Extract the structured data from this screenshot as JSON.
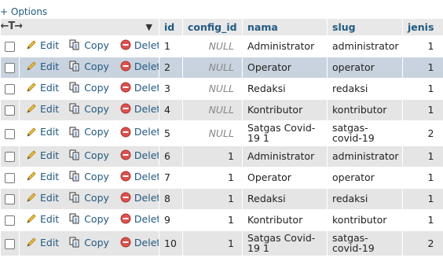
{
  "options_link": "+ Options",
  "columns": [
    "id",
    "config_id",
    "nama",
    "slug",
    "jenis"
  ],
  "actions": {
    "edit": "Edit",
    "copy": "Copy",
    "delete": "Delete"
  },
  "rows": [
    {
      "id": "1",
      "config_id": "NULL",
      "nama": "Administrator",
      "slug": "administrator",
      "jenis": "1"
    },
    {
      "id": "2",
      "config_id": "NULL",
      "nama": "Operator",
      "slug": "operator",
      "jenis": "1"
    },
    {
      "id": "3",
      "config_id": "NULL",
      "nama": "Redaksi",
      "slug": "redaksi",
      "jenis": "1"
    },
    {
      "id": "4",
      "config_id": "NULL",
      "nama": "Kontributor",
      "slug": "kontributor",
      "jenis": "1"
    },
    {
      "id": "5",
      "config_id": "NULL",
      "nama": "Satgas Covid-19 1",
      "slug": "satgas-covid-19",
      "jenis": "2"
    },
    {
      "id": "6",
      "config_id": "1",
      "nama": "Administrator",
      "slug": "administrator",
      "jenis": "1"
    },
    {
      "id": "7",
      "config_id": "1",
      "nama": "Operator",
      "slug": "operator",
      "jenis": "1"
    },
    {
      "id": "8",
      "config_id": "1",
      "nama": "Redaksi",
      "slug": "redaksi",
      "jenis": "1"
    },
    {
      "id": "9",
      "config_id": "1",
      "nama": "Kontributor",
      "slug": "kontributor",
      "jenis": "1"
    },
    {
      "id": "10",
      "config_id": "1",
      "nama": "Satgas Covid-19 1",
      "slug": "satgas-covid-19",
      "jenis": "2"
    }
  ],
  "icons": [
    "pencil-icon",
    "copy-icon",
    "delete-icon",
    "column-arrows-icon",
    "caret-down-icon"
  ],
  "colors": {
    "link": "#235a81",
    "header_bg": "#e8e8e8",
    "even_row": "#e5e5e5",
    "selected_row": "#c8d3df",
    "delete_red": "#d9534f"
  }
}
